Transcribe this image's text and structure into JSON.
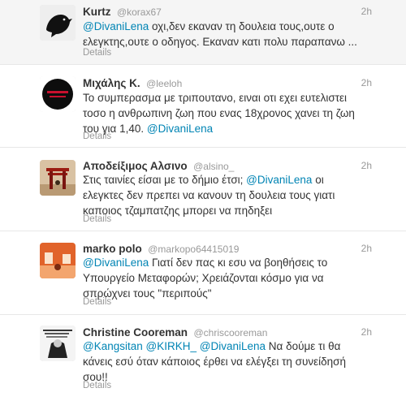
{
  "tweets": [
    {
      "name": "Kurtz",
      "handle": "@korax67",
      "time": "2h",
      "parts": [
        {
          "t": "@DivaniLena",
          "m": true
        },
        {
          "t": " οχι,δεν εκαναν τη δουλεια τους,ουτε ο ελεγκτης,ουτε ο οδηγος. Εκαναν κατι πολυ παραπανω ..."
        }
      ],
      "details": "Details",
      "avatar": "black-bird-avatar"
    },
    {
      "name": "Μιχάλης Κ.",
      "handle": "@leeloh",
      "time": "2h",
      "parts": [
        {
          "t": "Το συμπερασμα με τριπουτανο, ειναι οτι εχει ευτελιστει τοσο η ανθρωπινη ζωη που ενας 18χρονος χανει τη ζωη του για 1,40. "
        },
        {
          "t": "@DivaniLena",
          "m": true
        }
      ],
      "details": "Details",
      "avatar": "red-badge-avatar"
    },
    {
      "name": "Αποδείξιμος Αλσινο",
      "handle": "@alsino_",
      "time": "2h",
      "parts": [
        {
          "t": "Στις ταινίες είσαι με το δήμιο έτσι; "
        },
        {
          "t": "@DivaniLena",
          "m": true
        },
        {
          "t": " οι ελεγκτες δεν πρεπει να κανουν τη δουλεια τους γιατι καποιος τζαμπατζης μπορει να πηδηξει"
        }
      ],
      "details": "Details",
      "avatar": "torii-gate-avatar"
    },
    {
      "name": "marko polo",
      "handle": "@markopo64415019",
      "time": "2h",
      "parts": [
        {
          "t": "@DivaniLena",
          "m": true
        },
        {
          "t": " Γιατί δεν πας κι εσυ να βοηθήσεις το Υπουργείο Μεταφορών; Χρειάζονται κόσμο για να σπρώχνει τους \"περιπούς\""
        }
      ],
      "details": "Details",
      "avatar": "orange-room-avatar"
    },
    {
      "name": "Christine Cooreman",
      "handle": "@chriscooreman",
      "time": "2h",
      "parts": [
        {
          "t": "@Kangsitan",
          "m": true
        },
        {
          "t": " "
        },
        {
          "t": "@KIRKH_",
          "m": true
        },
        {
          "t": " "
        },
        {
          "t": "@DivaniLena",
          "m": true
        },
        {
          "t": " Να δούμε τι θα κάνεις εσύ όταν κάποιος έρθει να ελέγξει τη συνείδησή σου!!"
        }
      ],
      "details": "Details",
      "avatar": "bw-poster-avatar"
    }
  ],
  "colors": {
    "mention": "#0084b4",
    "muted": "#999999",
    "text": "#333333"
  }
}
